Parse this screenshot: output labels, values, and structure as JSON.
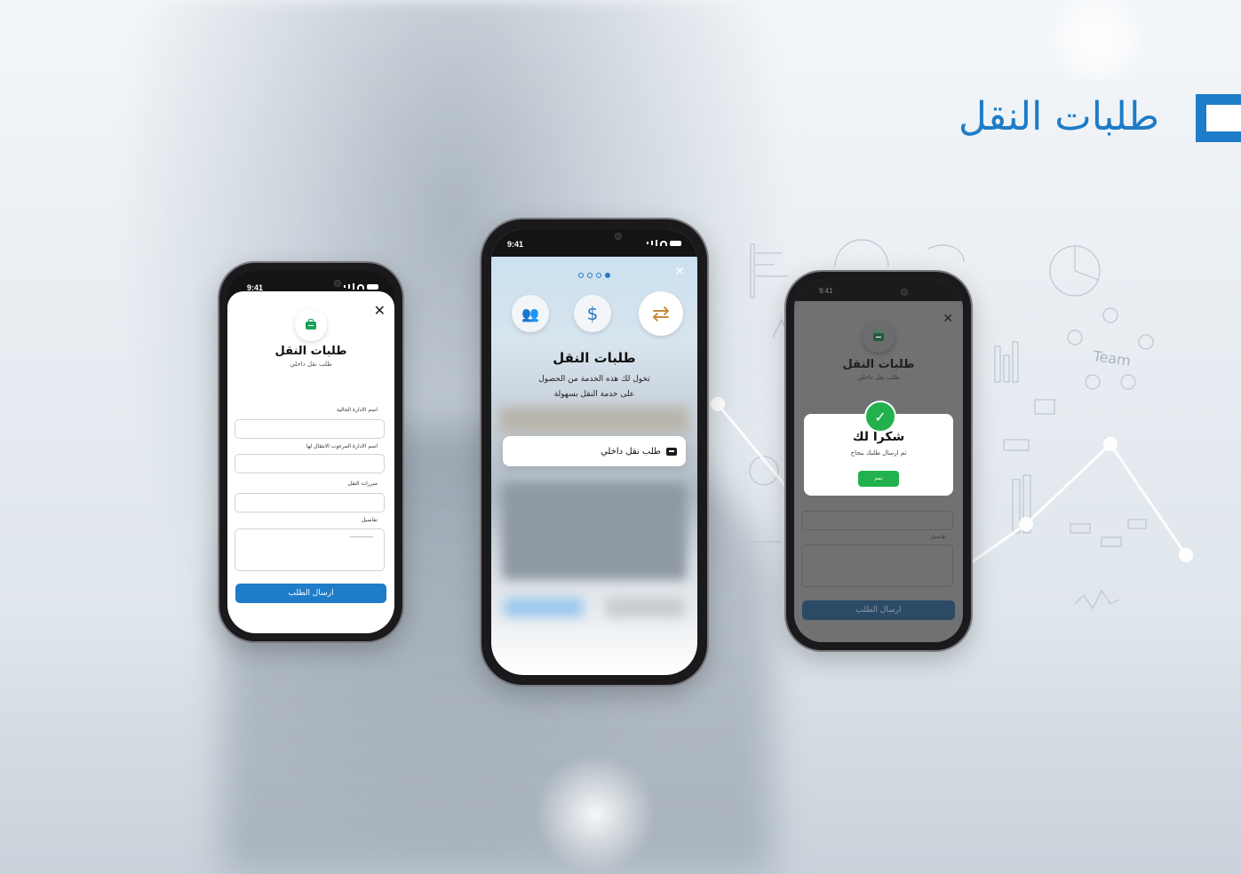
{
  "page": {
    "title": "طلبات النقل"
  },
  "phones": {
    "status_time": "9:41",
    "form": {
      "title": "طلبات النقل",
      "subtitle": "طلب نقل داخلي",
      "close_label": "✕",
      "fields": [
        {
          "label": "اسم الادارة الحالية",
          "value": ""
        },
        {
          "label": "اسم الادارة المرغوب الانتقال لها",
          "value": ""
        },
        {
          "label": "مبررات النقل",
          "value": ""
        },
        {
          "label": "تفاصيل",
          "value": ""
        }
      ],
      "submit_label": "ارسال الطلب"
    },
    "intro": {
      "title": "طلبات النقل",
      "description_line1": "تخول لك هذه الخدمة من الحصول",
      "description_line2": "على خدمة النقل بسهولة",
      "action_label": "طلب نقل داخلي",
      "close_label": "✕",
      "page_indicator": {
        "count": 4,
        "active": 4
      },
      "features": [
        {
          "icon": "team-icon",
          "glyph": "👥"
        },
        {
          "icon": "dollar-icon",
          "glyph": "$"
        },
        {
          "icon": "transfer-arrows-icon",
          "glyph": "⇄"
        }
      ]
    },
    "success": {
      "background_title": "طلبات النقل",
      "background_subtitle": "طلب نقل داخلي",
      "background_field_label": "تفاصيل",
      "background_submit": "ارسال الطلب",
      "close_label": "✕",
      "modal_title": "شكرا لك",
      "modal_message": "تم ارسال طلبك بنجاح",
      "ok_label": "تمم"
    }
  },
  "colors": {
    "brand_blue": "#1e7cc8",
    "success_green": "#22b14c",
    "icon_green": "#1aa15a"
  }
}
